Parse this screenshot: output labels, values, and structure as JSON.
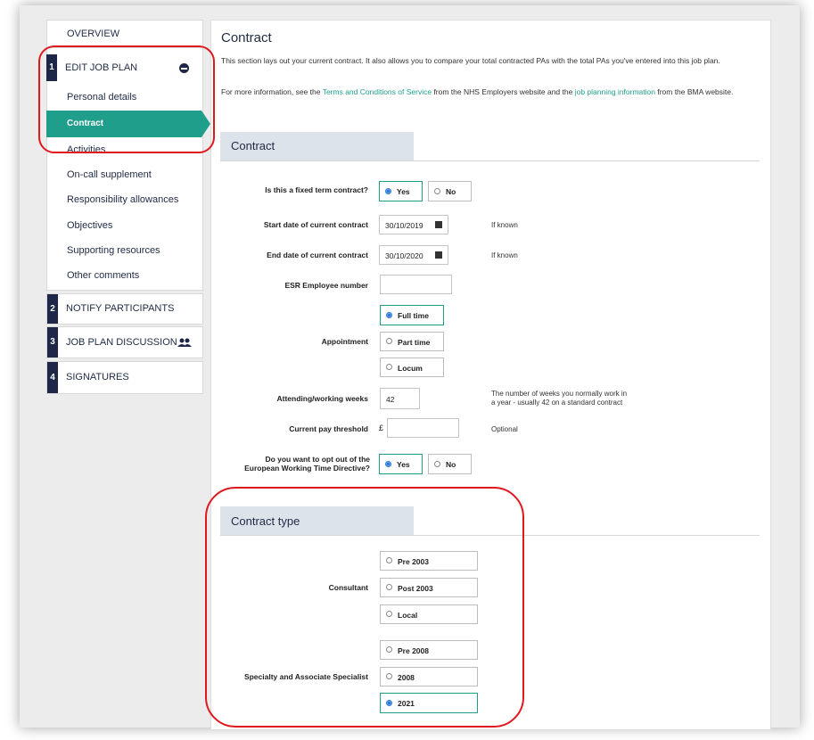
{
  "sidebar": {
    "overview": "OVERVIEW",
    "step1": {
      "num": "1",
      "label": "EDIT JOB PLAN"
    },
    "items": [
      "Personal details",
      "Contract",
      "Activities",
      "On-call supplement",
      "Responsibility allowances",
      "Objectives",
      "Supporting resources",
      "Other comments"
    ],
    "step2": {
      "num": "2",
      "label": "NOTIFY PARTICIPANTS"
    },
    "step3": {
      "num": "3",
      "label": "JOB PLAN DISCUSSION"
    },
    "step4": {
      "num": "4",
      "label": "SIGNATURES"
    }
  },
  "main": {
    "title": "Contract",
    "intro": "This section lays out your current contract. It also allows you to compare your total contracted PAs with the total PAs you've entered into this job plan.",
    "more_prefix": "For more information, see the ",
    "link1": "Terms and Conditions of Service",
    "more_mid": " from the NHS Employers website and the ",
    "link2": "job planning information",
    "more_suffix": " from the BMA website.",
    "contract_section": "Contract",
    "fixed_term": {
      "label": "Is this a fixed term contract?",
      "yes": "Yes",
      "no": "No"
    },
    "start_date": {
      "label": "Start date of current contract",
      "value": "30/10/2019",
      "hint": "If known"
    },
    "end_date": {
      "label": "End date of current contract",
      "value": "30/10/2020",
      "hint": "If known"
    },
    "esr": {
      "label": "ESR Employee number",
      "value": ""
    },
    "appointment": {
      "label": "Appointment",
      "options": [
        "Full time",
        "Part time",
        "Locum"
      ]
    },
    "weeks": {
      "label": "Attending/working weeks",
      "value": "42",
      "hint1": "The number of weeks you normally work in",
      "hint2": "a year - usually 42 on a standard contract"
    },
    "pay": {
      "label": "Current pay threshold",
      "currency": "£",
      "value": "",
      "hint": "Optional"
    },
    "ewtd": {
      "label1": "Do you want to opt out of the",
      "label2": "European Working Time Directive?",
      "yes": "Yes",
      "no": "No"
    },
    "contract_type_section": "Contract type",
    "consultant": {
      "label": "Consultant",
      "options": [
        "Pre 2003",
        "Post 2003",
        "Local"
      ]
    },
    "sas": {
      "label": "Specialty and Associate Specialist",
      "options": [
        "Pre 2008",
        "2008",
        "2021"
      ]
    }
  },
  "colors": {
    "accent": "#1f9e8b",
    "navy": "#1e2747",
    "highlight_ring": "#e0191f"
  }
}
